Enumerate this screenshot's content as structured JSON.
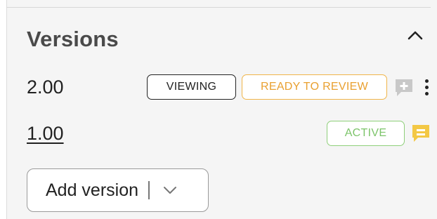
{
  "panel": {
    "title": "Versions"
  },
  "versions": [
    {
      "number": "2.00",
      "badges": [
        {
          "label": "VIEWING",
          "color": "#222222"
        },
        {
          "label": "READY TO REVIEW",
          "color": "#e9a030"
        }
      ],
      "comment_icon": "add-comment-icon",
      "comment_icon_color": "#c8c8c8"
    },
    {
      "number": "1.00",
      "badges": [
        {
          "label": "ACTIVE",
          "color": "#7cc46a"
        }
      ],
      "comment_icon": "comment-icon",
      "comment_icon_color": "#f3c845"
    }
  ],
  "add_version": {
    "label": "Add version"
  },
  "icons": {
    "collapse": "chevron-up-icon",
    "more": "more-vertical-icon",
    "dropdown": "chevron-down-icon"
  }
}
